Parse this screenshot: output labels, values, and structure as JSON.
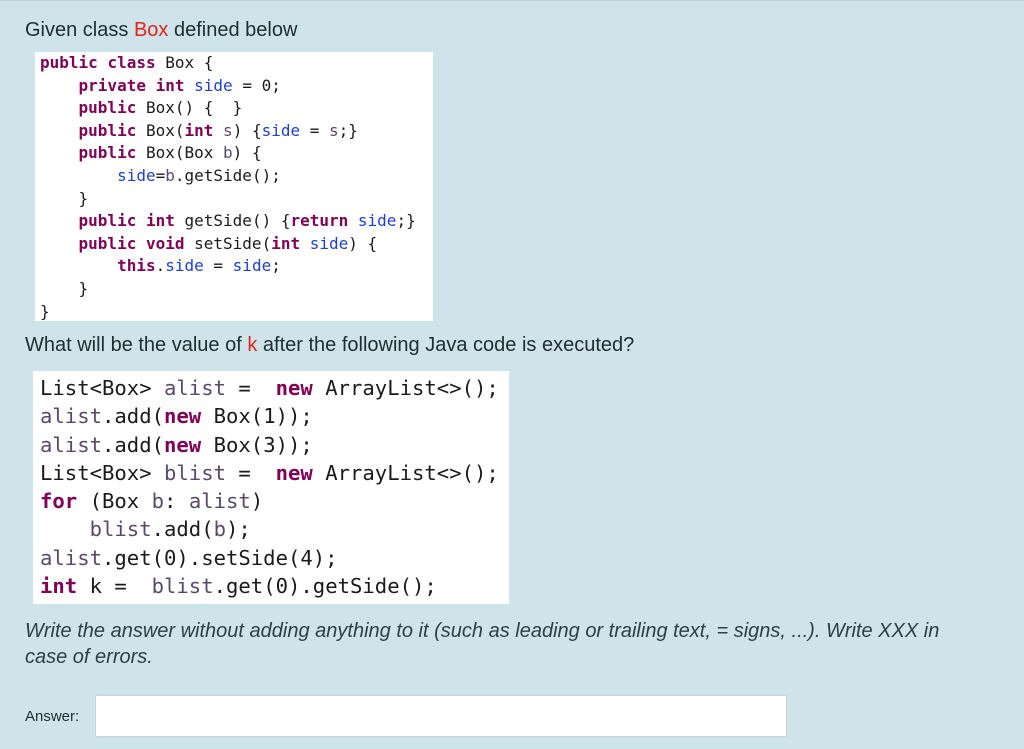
{
  "question": {
    "intro_prefix": "Given class ",
    "intro_class": "Box",
    "intro_suffix": " defined below",
    "question_prefix": "What will be the value of ",
    "question_var": "k",
    "question_suffix": " after the following Java code is executed?",
    "note": "Write the answer without adding anything to it (such as leading or trailing text, = signs, ...). Write XXX in case of errors."
  },
  "class_code": [
    "public class Box {",
    "    private int side = 0;",
    "    public Box() {  }",
    "    public Box(int s) {side = s;}",
    "    public Box(Box b) {",
    "        side=b.getSide();",
    "    }",
    "    public int getSide() {return side;}",
    "    public void setSide(int side) {",
    "        this.side = side;",
    "    }",
    "}"
  ],
  "main_code": [
    "List<Box> alist =  new ArrayList<>();",
    "alist.add(new Box(1));",
    "alist.add(new Box(3));",
    "List<Box> blist =  new ArrayList<>();",
    "for (Box b: alist)",
    "    blist.add(b);",
    "alist.get(0).setSide(4);",
    "int k =  blist.get(0).getSide();"
  ],
  "answer": {
    "label": "Answer:",
    "value": ""
  },
  "colors": {
    "panel_bg": "#cfe3ea",
    "accent": "#e0261c",
    "keyword": "#7f0055",
    "field": "#1f3fd0"
  }
}
